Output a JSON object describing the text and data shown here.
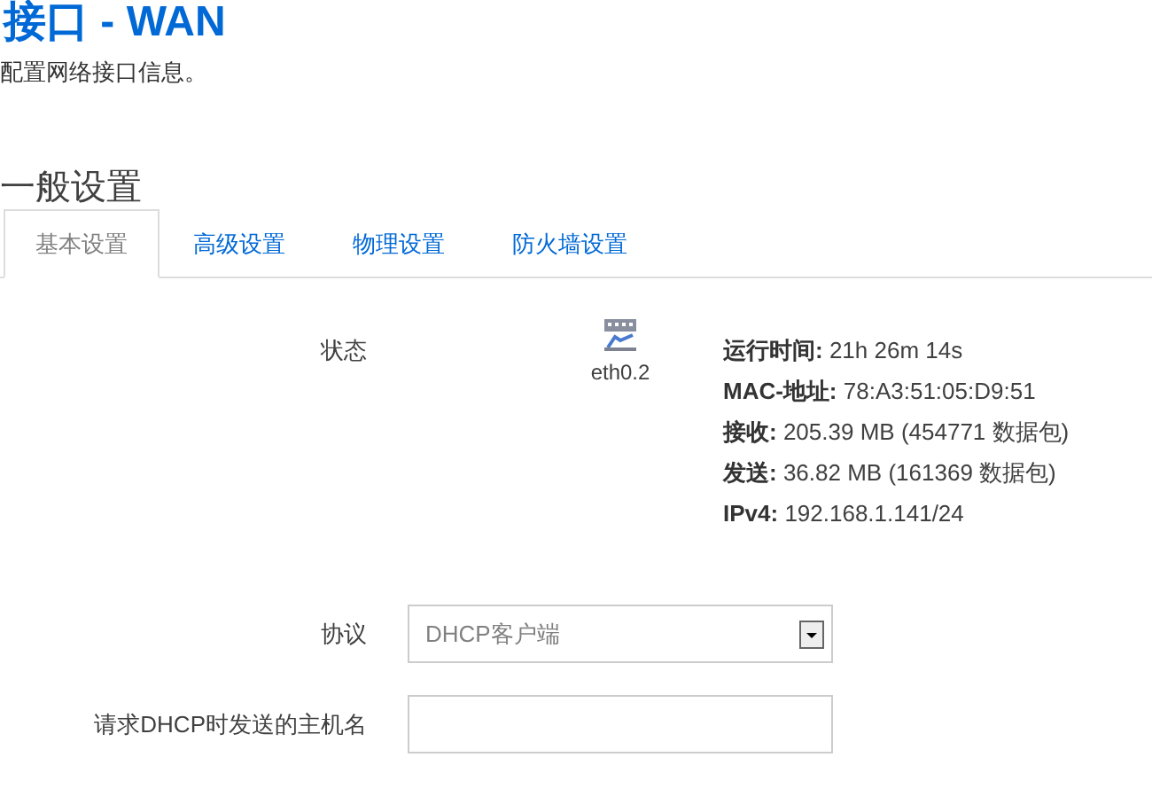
{
  "page": {
    "title": "接口 - WAN",
    "description": "配置网络接口信息。"
  },
  "section": {
    "title": "一般设置"
  },
  "tabs": [
    {
      "label": "基本设置",
      "selected": true
    },
    {
      "label": "高级设置",
      "selected": false
    },
    {
      "label": "物理设置",
      "selected": false
    },
    {
      "label": "防火墙设置",
      "selected": false
    }
  ],
  "status": {
    "label": "状态",
    "device": "eth0.2",
    "lines": [
      {
        "key": "运行时间:",
        "value": "21h 26m 14s"
      },
      {
        "key": "MAC-地址:",
        "value": "78:A3:51:05:D9:51"
      },
      {
        "key": "接收:",
        "value": "205.39 MB (454771 数据包)"
      },
      {
        "key": "发送:",
        "value": "36.82 MB (161369 数据包)"
      },
      {
        "key": "IPv4:",
        "value": "192.168.1.141/24"
      }
    ]
  },
  "fields": [
    {
      "kind": "select",
      "label": "协议",
      "value": "DHCP客户端"
    },
    {
      "kind": "text",
      "label": "请求DHCP时发送的主机名"
    }
  ]
}
